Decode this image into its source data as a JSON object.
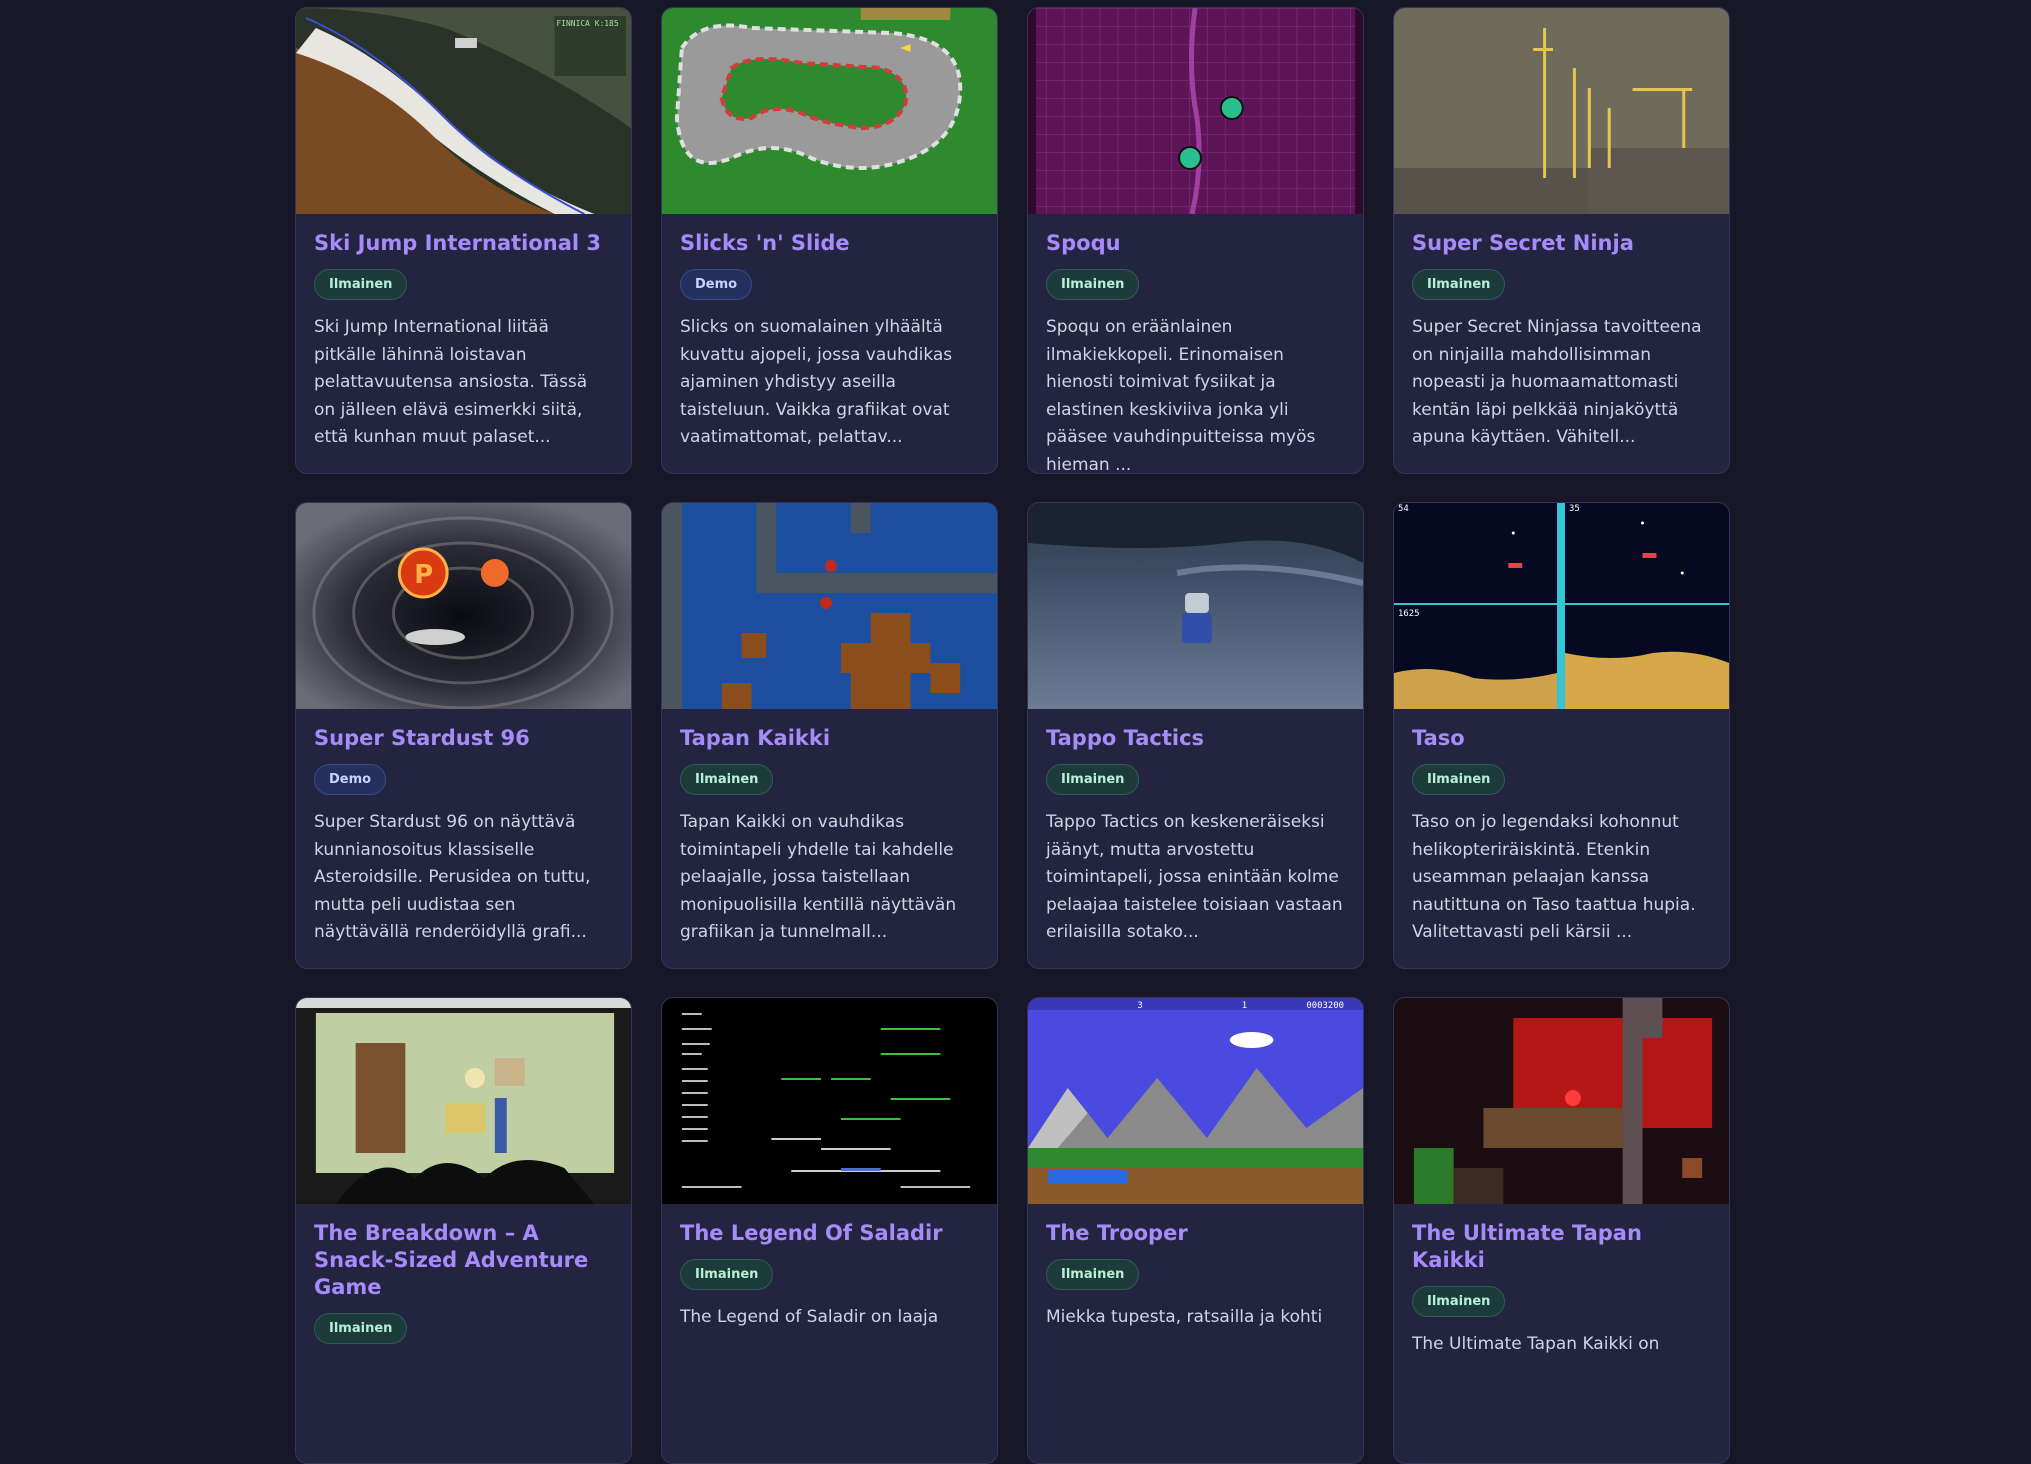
{
  "games": [
    {
      "title": "Ski Jump International 3",
      "badge": "Ilmainen",
      "desc": "Ski Jump International liitää pitkälle lähinnä loistavan pelattavuutensa ansiosta. Tässä on jälleen elävä esimerkki siitä, että kunhan muut palaset..."
    },
    {
      "title": "Slicks 'n' Slide",
      "badge": "Demo",
      "desc": "Slicks on suomalainen ylhäältä kuvattu ajopeli, jossa vauhdikas ajaminen yhdistyy aseilla taisteluun. Vaikka grafiikat ovat vaatimattomat, pelattav..."
    },
    {
      "title": "Spoqu",
      "badge": "Ilmainen",
      "desc": "Spoqu on eräänlainen ilmakiekkopeli. Erinomaisen hienosti toimivat fysiikat ja elastinen keskiviiva jonka yli pääsee vauhdinpuitteissa myös hieman ..."
    },
    {
      "title": "Super Secret Ninja",
      "badge": "Ilmainen",
      "desc": "Super Secret Ninjassa tavoitteena on ninjailla mahdollisimman nopeasti ja huomaamattomasti kentän läpi pelkkää ninjaköyttä apuna käyttäen. Vähitell..."
    },
    {
      "title": "Super Stardust 96",
      "badge": "Demo",
      "desc": "Super Stardust 96 on näyttävä kunnianosoitus klassiselle Asteroidsille. Perusidea on tuttu, mutta peli uudistaa sen näyttävällä renderöidyllä grafi..."
    },
    {
      "title": "Tapan Kaikki",
      "badge": "Ilmainen",
      "desc": "Tapan Kaikki on vauhdikas toimintapeli yhdelle tai kahdelle pelaajalle, jossa taistellaan monipuolisilla kentillä näyttävän grafiikan ja tunnelmall..."
    },
    {
      "title": "Tappo Tactics",
      "badge": "Ilmainen",
      "desc": "Tappo Tactics on keskeneräiseksi jäänyt, mutta arvostettu toimintapeli, jossa enintään kolme pelaajaa taistelee toisiaan vastaan erilaisilla sotako..."
    },
    {
      "title": "Taso",
      "badge": "Ilmainen",
      "desc": "Taso on jo legendaksi kohonnut helikopteriräiskintä. Etenkin useamman pelaajan kanssa nautittuna on Taso taattua hupia. Valitettavasti peli kärsii ..."
    },
    {
      "title": "The Breakdown – A Snack-Sized Adventure Game",
      "badge": "Ilmainen",
      "desc": ""
    },
    {
      "title": "The Legend Of Saladir",
      "badge": "Ilmainen",
      "desc": "The Legend of Saladir on laaja"
    },
    {
      "title": "The Trooper",
      "badge": "Ilmainen",
      "desc": "Miekka tupesta, ratsailla ja kohti"
    },
    {
      "title": "The Ultimate Tapan Kaikki",
      "badge": "Ilmainen",
      "desc": "The Ultimate Tapan Kaikki on"
    }
  ],
  "thumb_text": {
    "skijump_hud": "FINNICA K:185",
    "taso_score_a": "54",
    "taso_score_b": "35",
    "taso_score_c": "1625",
    "trooper_num_a": "3",
    "trooper_num_b": "1",
    "trooper_score": "0003200"
  },
  "colors": {
    "title": "#a78bfa",
    "free_badge_bg": "#1c3b3a",
    "demo_badge_bg": "#24305e",
    "card_bg": "#23243f",
    "page_bg": "#171728"
  }
}
